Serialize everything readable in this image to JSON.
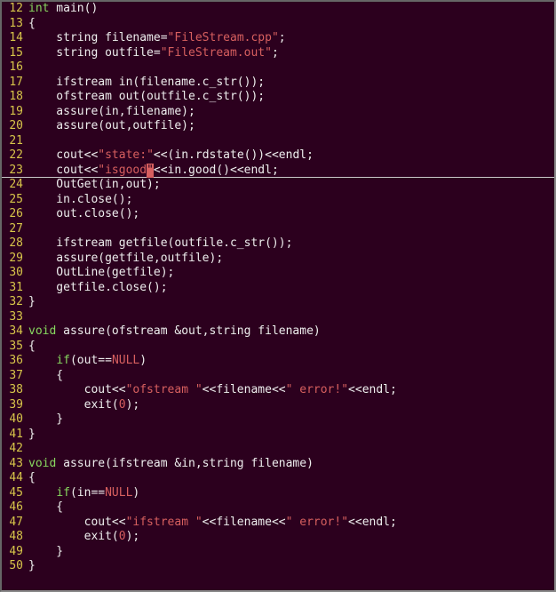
{
  "colors": {
    "bg": "#2c001e",
    "fg": "#eeeeee",
    "keyword": "#87d75f",
    "string": "#d75f5f",
    "gutter": "#d7c54a"
  },
  "highlighted_line": 23,
  "lines": [
    {
      "n": 12,
      "tokens": [
        [
          "kw",
          "int"
        ],
        [
          "",
          " main()"
        ]
      ]
    },
    {
      "n": 13,
      "tokens": [
        [
          "",
          "{"
        ]
      ]
    },
    {
      "n": 14,
      "tokens": [
        [
          "",
          "    string filename="
        ],
        [
          "str",
          "\"FileStream.cpp\""
        ],
        [
          "",
          ";"
        ]
      ]
    },
    {
      "n": 15,
      "tokens": [
        [
          "",
          "    string outfile="
        ],
        [
          "str",
          "\"FileStream.out\""
        ],
        [
          "",
          ";"
        ]
      ]
    },
    {
      "n": 16,
      "tokens": []
    },
    {
      "n": 17,
      "tokens": [
        [
          "",
          "    ifstream in(filename.c_str());"
        ]
      ]
    },
    {
      "n": 18,
      "tokens": [
        [
          "",
          "    ofstream out(outfile.c_str());"
        ]
      ]
    },
    {
      "n": 19,
      "tokens": [
        [
          "",
          "    assure(in,filename);"
        ]
      ]
    },
    {
      "n": 20,
      "tokens": [
        [
          "",
          "    assure(out,outfile);"
        ]
      ]
    },
    {
      "n": 21,
      "tokens": []
    },
    {
      "n": 22,
      "tokens": [
        [
          "",
          "    cout<<"
        ],
        [
          "str",
          "\"state:\""
        ],
        [
          "",
          "<<(in.rdstate())<<endl;"
        ]
      ]
    },
    {
      "n": 23,
      "tokens": [
        [
          "",
          "    cout<<"
        ],
        [
          "str",
          "\"isgood"
        ],
        [
          "cursor",
          "\""
        ],
        [
          "",
          "<<in.good()<<endl;"
        ]
      ]
    },
    {
      "n": 24,
      "tokens": [
        [
          "",
          "    OutGet(in,out);"
        ]
      ]
    },
    {
      "n": 25,
      "tokens": [
        [
          "",
          "    in.close();"
        ]
      ]
    },
    {
      "n": 26,
      "tokens": [
        [
          "",
          "    out.close();"
        ]
      ]
    },
    {
      "n": 27,
      "tokens": []
    },
    {
      "n": 28,
      "tokens": [
        [
          "",
          "    ifstream getfile(outfile.c_str());"
        ]
      ]
    },
    {
      "n": 29,
      "tokens": [
        [
          "",
          "    assure(getfile,outfile);"
        ]
      ]
    },
    {
      "n": 30,
      "tokens": [
        [
          "",
          "    OutLine(getfile);"
        ]
      ]
    },
    {
      "n": 31,
      "tokens": [
        [
          "",
          "    getfile.close();"
        ]
      ]
    },
    {
      "n": 32,
      "tokens": [
        [
          "",
          "}"
        ]
      ]
    },
    {
      "n": 33,
      "tokens": []
    },
    {
      "n": 34,
      "tokens": [
        [
          "kw",
          "void"
        ],
        [
          "",
          " assure(ofstream &out,string filename)"
        ]
      ]
    },
    {
      "n": 35,
      "tokens": [
        [
          "",
          "{"
        ]
      ]
    },
    {
      "n": 36,
      "tokens": [
        [
          "",
          "    "
        ],
        [
          "kw",
          "if"
        ],
        [
          "",
          "(out=="
        ],
        [
          "null",
          "NULL"
        ],
        [
          "",
          ")"
        ]
      ]
    },
    {
      "n": 37,
      "tokens": [
        [
          "",
          "    {"
        ]
      ]
    },
    {
      "n": 38,
      "tokens": [
        [
          "",
          "        cout<<"
        ],
        [
          "str",
          "\"ofstream \""
        ],
        [
          "",
          "<<filename<<"
        ],
        [
          "str",
          "\" error!\""
        ],
        [
          "",
          "<<endl;"
        ]
      ]
    },
    {
      "n": 39,
      "tokens": [
        [
          "",
          "        exit("
        ],
        [
          "num",
          "0"
        ],
        [
          "",
          ");"
        ]
      ]
    },
    {
      "n": 40,
      "tokens": [
        [
          "",
          "    }"
        ]
      ]
    },
    {
      "n": 41,
      "tokens": [
        [
          "",
          "}"
        ]
      ]
    },
    {
      "n": 42,
      "tokens": []
    },
    {
      "n": 43,
      "tokens": [
        [
          "kw",
          "void"
        ],
        [
          "",
          " assure(ifstream &in,string filename)"
        ]
      ]
    },
    {
      "n": 44,
      "tokens": [
        [
          "",
          "{"
        ]
      ]
    },
    {
      "n": 45,
      "tokens": [
        [
          "",
          "    "
        ],
        [
          "kw",
          "if"
        ],
        [
          "",
          "(in=="
        ],
        [
          "null",
          "NULL"
        ],
        [
          "",
          ")"
        ]
      ]
    },
    {
      "n": 46,
      "tokens": [
        [
          "",
          "    {"
        ]
      ]
    },
    {
      "n": 47,
      "tokens": [
        [
          "",
          "        cout<<"
        ],
        [
          "str",
          "\"ifstream \""
        ],
        [
          "",
          "<<filename<<"
        ],
        [
          "str",
          "\" error!\""
        ],
        [
          "",
          "<<endl;"
        ]
      ]
    },
    {
      "n": 48,
      "tokens": [
        [
          "",
          "        exit("
        ],
        [
          "num",
          "0"
        ],
        [
          "",
          ");"
        ]
      ]
    },
    {
      "n": 49,
      "tokens": [
        [
          "",
          "    }"
        ]
      ]
    },
    {
      "n": 50,
      "tokens": [
        [
          "",
          "}"
        ]
      ]
    }
  ]
}
